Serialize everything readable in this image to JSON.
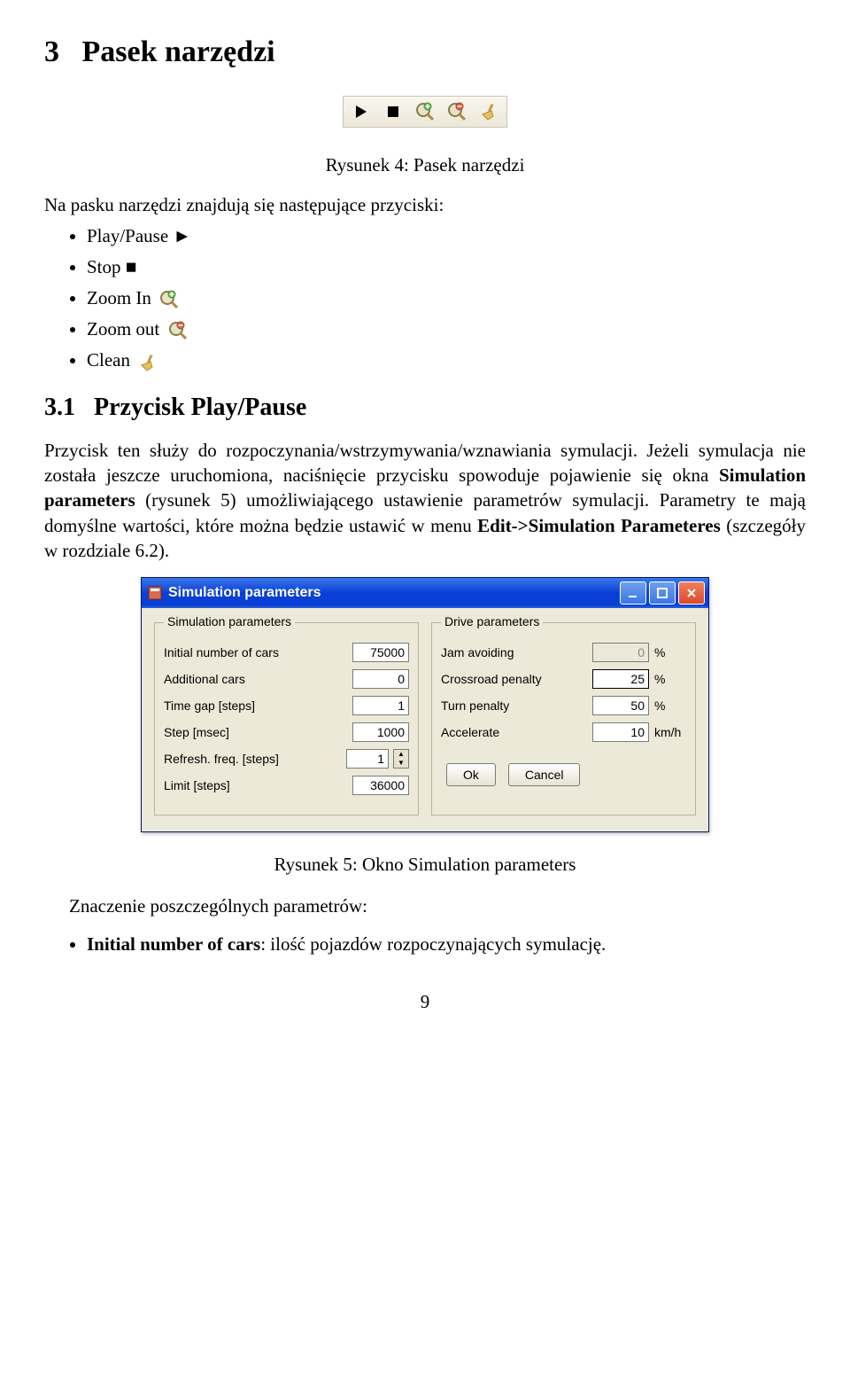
{
  "section": {
    "number": "3",
    "title": "Pasek narzędzi"
  },
  "figure4_caption": "Rysunek 4: Pasek narzędzi",
  "lead_text": "Na pasku narzędzi znajdują się następujące przyciski:",
  "toolbar_items": {
    "play": "Play/Pause ►",
    "stop": "Stop ■",
    "zoomin": "Zoom In",
    "zoomout": "Zoom out",
    "clean": "Clean"
  },
  "subsection": {
    "number": "3.1",
    "title": "Przycisk Play/Pause"
  },
  "para1_a": "Przycisk ten służy do rozpoczynania/wstrzymywania/wznawiania symulacji. Jeżeli symulacja nie została jeszcze uruchomiona, naciśnięcie przycisku spowoduje pojawienie się okna ",
  "para1_b": "Simulation parameters",
  "para1_c": " (rysunek 5) umożliwiającego ustawienie parametrów symulacji. Parametry te mają domyślne wartości, które można będzie ustawić w menu ",
  "para1_d": "Edit->Simulation Parameteres",
  "para1_e": " (szczegóły w rozdziale 6.2).",
  "dialog": {
    "title": "Simulation parameters",
    "left": {
      "legend": "Simulation parameters",
      "rows": {
        "initial": {
          "label": "Initial number of cars",
          "value": "75000"
        },
        "additional": {
          "label": "Additional cars",
          "value": "0"
        },
        "timegap": {
          "label": "Time gap [steps]",
          "value": "1"
        },
        "step": {
          "label": "Step   [msec]",
          "value": "1000"
        },
        "refresh": {
          "label": "Refresh. freq. [steps]",
          "value": "1"
        },
        "limit": {
          "label": "Limit [steps]",
          "value": "36000"
        }
      }
    },
    "right": {
      "legend": "Drive parameters",
      "rows": {
        "jam": {
          "label": "Jam avoiding",
          "value": "0",
          "unit": "%"
        },
        "crossroad": {
          "label": "Crossroad penalty",
          "value": "25",
          "unit": "%"
        },
        "turn": {
          "label": "Turn penalty",
          "value": "50",
          "unit": "%"
        },
        "accelerate": {
          "label": "Accelerate",
          "value": "10",
          "unit": "km/h"
        }
      },
      "ok": "Ok",
      "cancel": "Cancel"
    }
  },
  "figure5_caption": "Rysunek 5: Okno Simulation parameters",
  "meaning_line": "Znaczenie poszczególnych parametrów:",
  "param_initial_bold": "Initial number of cars",
  "param_initial_rest": ": ilość pojazdów rozpoczynających symulację.",
  "page_number": "9"
}
